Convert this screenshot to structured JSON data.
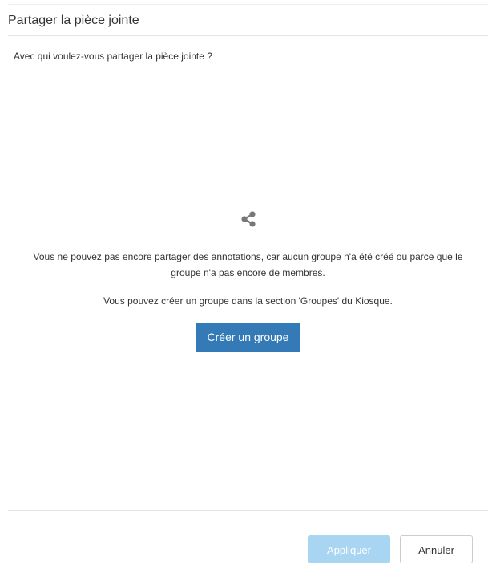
{
  "dialog": {
    "title": "Partager la pièce jointe",
    "question": "Avec qui voulez-vous partager la pièce jointe ?"
  },
  "empty_state": {
    "icon": "share-icon",
    "message": "Vous ne pouvez pas encore partager des annotations, car aucun groupe n'a été créé ou parce que le groupe n'a pas encore de membres.",
    "hint": "Vous pouvez créer un groupe dans la section 'Groupes' du Kiosque.",
    "create_label": "Créer un groupe"
  },
  "footer": {
    "apply_label": "Appliquer",
    "cancel_label": "Annuler"
  },
  "colors": {
    "primary": "#337ab7",
    "primary_disabled": "#a8d5f2",
    "icon": "#777777",
    "text": "#333333"
  }
}
